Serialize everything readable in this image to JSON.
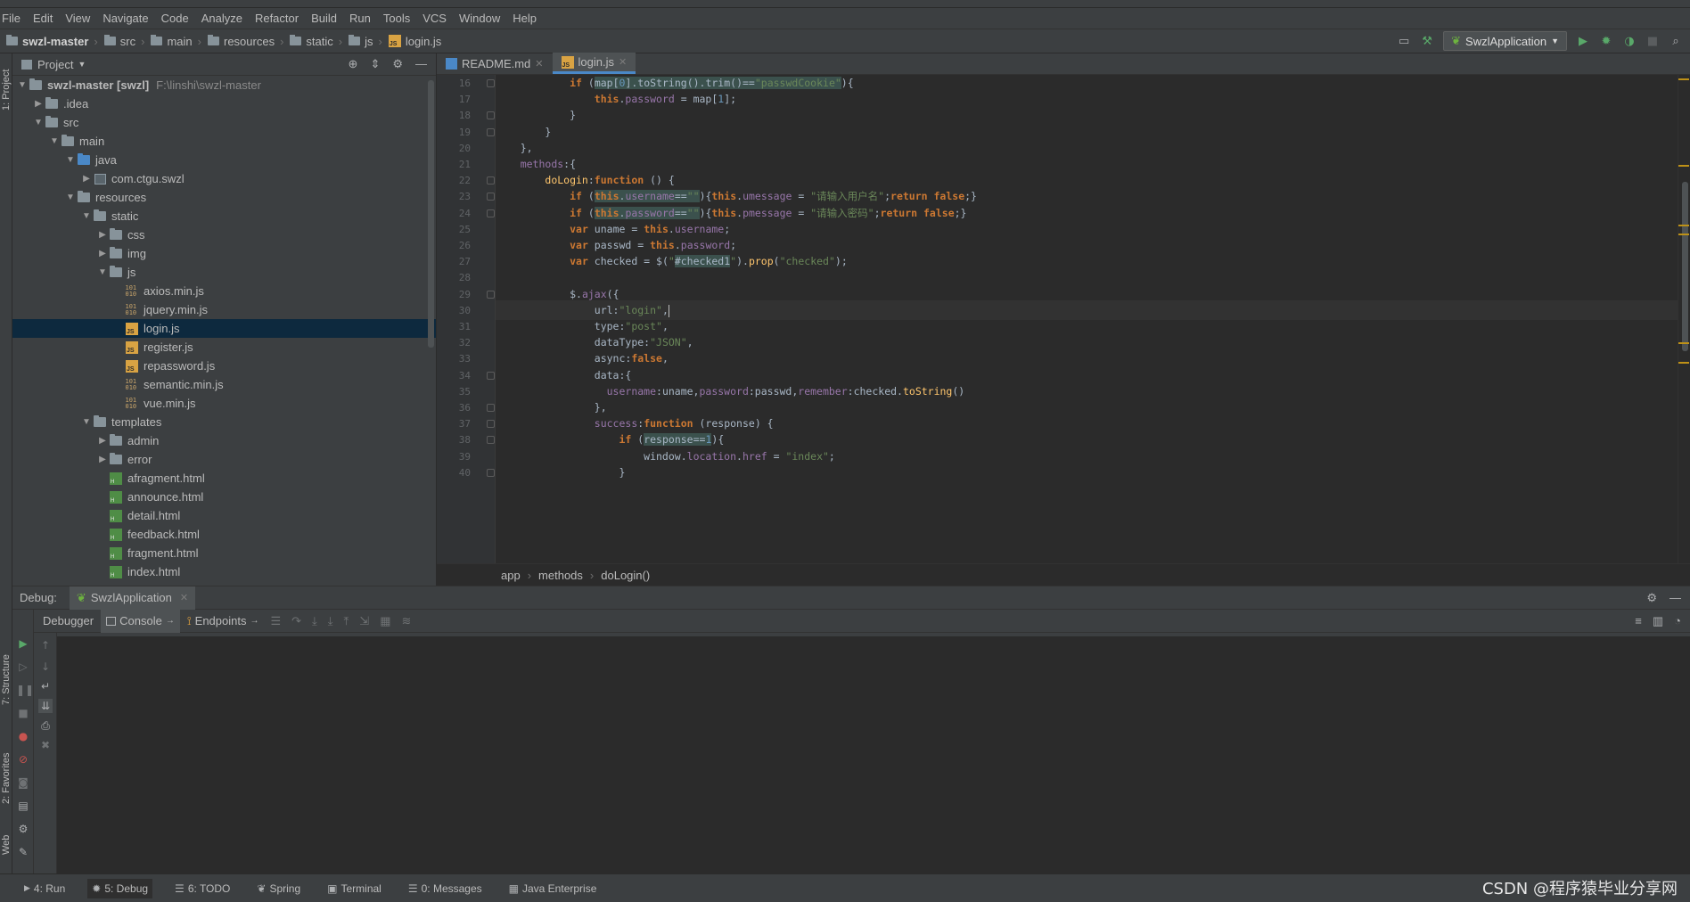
{
  "menu": [
    "File",
    "Edit",
    "View",
    "Navigate",
    "Code",
    "Analyze",
    "Refactor",
    "Build",
    "Run",
    "Tools",
    "VCS",
    "Window",
    "Help"
  ],
  "breadcrumbs": [
    "swzl-master",
    "src",
    "main",
    "resources",
    "static",
    "js",
    "login.js"
  ],
  "run_config": "SwzlApplication",
  "project": {
    "title": "Project",
    "tree": [
      {
        "label": "swzl-master [swzl]",
        "extra": "F:\\linshi\\swzl-master",
        "depth": 0,
        "type": "folder",
        "open": true,
        "bold": true
      },
      {
        "label": ".idea",
        "depth": 1,
        "type": "folder",
        "open": false
      },
      {
        "label": "src",
        "depth": 1,
        "type": "folder",
        "open": true
      },
      {
        "label": "main",
        "depth": 2,
        "type": "folder",
        "open": true
      },
      {
        "label": "java",
        "depth": 3,
        "type": "folder-blue",
        "open": true
      },
      {
        "label": "com.ctgu.swzl",
        "depth": 4,
        "type": "package",
        "open": false
      },
      {
        "label": "resources",
        "depth": 3,
        "type": "folder",
        "open": true
      },
      {
        "label": "static",
        "depth": 4,
        "type": "folder",
        "open": true
      },
      {
        "label": "css",
        "depth": 5,
        "type": "folder",
        "open": false
      },
      {
        "label": "img",
        "depth": 5,
        "type": "folder",
        "open": false
      },
      {
        "label": "js",
        "depth": 5,
        "type": "folder",
        "open": true
      },
      {
        "label": "axios.min.js",
        "depth": 6,
        "type": "bin"
      },
      {
        "label": "jquery.min.js",
        "depth": 6,
        "type": "bin"
      },
      {
        "label": "login.js",
        "depth": 6,
        "type": "js",
        "selected": true
      },
      {
        "label": "register.js",
        "depth": 6,
        "type": "js"
      },
      {
        "label": "repassword.js",
        "depth": 6,
        "type": "js"
      },
      {
        "label": "semantic.min.js",
        "depth": 6,
        "type": "bin"
      },
      {
        "label": "vue.min.js",
        "depth": 6,
        "type": "bin"
      },
      {
        "label": "templates",
        "depth": 4,
        "type": "folder",
        "open": true
      },
      {
        "label": "admin",
        "depth": 5,
        "type": "folder",
        "open": false
      },
      {
        "label": "error",
        "depth": 5,
        "type": "folder",
        "open": false
      },
      {
        "label": "afragment.html",
        "depth": 5,
        "type": "html"
      },
      {
        "label": "announce.html",
        "depth": 5,
        "type": "html"
      },
      {
        "label": "detail.html",
        "depth": 5,
        "type": "html"
      },
      {
        "label": "feedback.html",
        "depth": 5,
        "type": "html"
      },
      {
        "label": "fragment.html",
        "depth": 5,
        "type": "html"
      },
      {
        "label": "index.html",
        "depth": 5,
        "type": "html"
      }
    ]
  },
  "editor": {
    "tabs": [
      {
        "label": "README.md",
        "active": false
      },
      {
        "label": "login.js",
        "active": true
      }
    ],
    "first_line": 16,
    "current_line": 30,
    "lines": [
      [
        {
          "t": "            "
        },
        {
          "t": "if",
          "c": "kw"
        },
        {
          "t": " ("
        },
        {
          "t": "map[",
          "c": "hl"
        },
        {
          "t": "0",
          "c": "nu hl"
        },
        {
          "t": "].toString().trim()==",
          "c": "hl"
        },
        {
          "t": "\"passwdCookie\"",
          "c": "st hl"
        },
        {
          "t": "){"
        }
      ],
      [
        {
          "t": "                "
        },
        {
          "t": "this",
          "c": "kw"
        },
        {
          "t": "."
        },
        {
          "t": "password",
          "c": "pr"
        },
        {
          "t": " = map["
        },
        {
          "t": "1",
          "c": "nu"
        },
        {
          "t": "];"
        }
      ],
      [
        {
          "t": "            }"
        }
      ],
      [
        {
          "t": "        }"
        }
      ],
      [
        {
          "t": "    },"
        }
      ],
      [
        {
          "t": "    "
        },
        {
          "t": "methods",
          "c": "pr"
        },
        {
          "t": ":{"
        }
      ],
      [
        {
          "t": "        "
        },
        {
          "t": "doLogin",
          "c": "fn"
        },
        {
          "t": ":"
        },
        {
          "t": "function",
          "c": "kw"
        },
        {
          "t": " () {"
        }
      ],
      [
        {
          "t": "            "
        },
        {
          "t": "if",
          "c": "kw"
        },
        {
          "t": " ("
        },
        {
          "t": "this",
          "c": "kw hl"
        },
        {
          "t": ".",
          "c": "hl"
        },
        {
          "t": "username",
          "c": "pr hl"
        },
        {
          "t": "==",
          "c": "hl"
        },
        {
          "t": "\"\"",
          "c": "st hl"
        },
        {
          "t": "){"
        },
        {
          "t": "this",
          "c": "kw"
        },
        {
          "t": "."
        },
        {
          "t": "umessage",
          "c": "pr"
        },
        {
          "t": " = "
        },
        {
          "t": "\"请输入用户名\"",
          "c": "st"
        },
        {
          "t": ";"
        },
        {
          "t": "return false",
          "c": "kw"
        },
        {
          "t": ";}"
        }
      ],
      [
        {
          "t": "            "
        },
        {
          "t": "if",
          "c": "kw"
        },
        {
          "t": " ("
        },
        {
          "t": "this",
          "c": "kw hl"
        },
        {
          "t": ".",
          "c": "hl"
        },
        {
          "t": "password",
          "c": "pr hl"
        },
        {
          "t": "==",
          "c": "hl"
        },
        {
          "t": "\"\"",
          "c": "st hl"
        },
        {
          "t": "){"
        },
        {
          "t": "this",
          "c": "kw"
        },
        {
          "t": "."
        },
        {
          "t": "pmessage",
          "c": "pr"
        },
        {
          "t": " = "
        },
        {
          "t": "\"请输入密码\"",
          "c": "st"
        },
        {
          "t": ";"
        },
        {
          "t": "return false",
          "c": "kw"
        },
        {
          "t": ";}"
        }
      ],
      [
        {
          "t": "            "
        },
        {
          "t": "var",
          "c": "kw"
        },
        {
          "t": " uname = "
        },
        {
          "t": "this",
          "c": "kw"
        },
        {
          "t": "."
        },
        {
          "t": "username",
          "c": "pr"
        },
        {
          "t": ";"
        }
      ],
      [
        {
          "t": "            "
        },
        {
          "t": "var",
          "c": "kw"
        },
        {
          "t": " passwd = "
        },
        {
          "t": "this",
          "c": "kw"
        },
        {
          "t": "."
        },
        {
          "t": "password",
          "c": "pr"
        },
        {
          "t": ";"
        }
      ],
      [
        {
          "t": "            "
        },
        {
          "t": "var",
          "c": "kw"
        },
        {
          "t": " checked = $("
        },
        {
          "t": "\"",
          "c": "st"
        },
        {
          "t": "#checked1",
          "c": "hl"
        },
        {
          "t": "\"",
          "c": "st"
        },
        {
          "t": ")."
        },
        {
          "t": "prop",
          "c": "fn"
        },
        {
          "t": "("
        },
        {
          "t": "\"checked\"",
          "c": "st"
        },
        {
          "t": ");"
        }
      ],
      [
        {
          "t": ""
        }
      ],
      [
        {
          "t": "            $."
        },
        {
          "t": "ajax",
          "c": "pr"
        },
        {
          "t": "({"
        }
      ],
      [
        {
          "t": "                url:"
        },
        {
          "t": "\"login\"",
          "c": "st"
        },
        {
          "t": ","
        }
      ],
      [
        {
          "t": "                type:"
        },
        {
          "t": "\"post\"",
          "c": "st"
        },
        {
          "t": ","
        }
      ],
      [
        {
          "t": "                dataType:"
        },
        {
          "t": "\"JSON\"",
          "c": "st"
        },
        {
          "t": ","
        }
      ],
      [
        {
          "t": "                async:"
        },
        {
          "t": "false",
          "c": "kw"
        },
        {
          "t": ","
        }
      ],
      [
        {
          "t": "                data:{"
        }
      ],
      [
        {
          "t": "                  "
        },
        {
          "t": "username",
          "c": "pr"
        },
        {
          "t": ":uname,"
        },
        {
          "t": "password",
          "c": "pr"
        },
        {
          "t": ":passwd,"
        },
        {
          "t": "remember",
          "c": "pr"
        },
        {
          "t": ":checked."
        },
        {
          "t": "toString",
          "c": "fn"
        },
        {
          "t": "()"
        }
      ],
      [
        {
          "t": "                },"
        }
      ],
      [
        {
          "t": "                "
        },
        {
          "t": "success",
          "c": "pr"
        },
        {
          "t": ":"
        },
        {
          "t": "function",
          "c": "kw"
        },
        {
          "t": " (response) {"
        }
      ],
      [
        {
          "t": "                    "
        },
        {
          "t": "if",
          "c": "kw"
        },
        {
          "t": " ("
        },
        {
          "t": "response==",
          "c": "hl"
        },
        {
          "t": "1",
          "c": "nu hl"
        },
        {
          "t": "){"
        }
      ],
      [
        {
          "t": "                        window."
        },
        {
          "t": "location",
          "c": "pr"
        },
        {
          "t": "."
        },
        {
          "t": "href",
          "c": "pr"
        },
        {
          "t": " = "
        },
        {
          "t": "\"index\"",
          "c": "st"
        },
        {
          "t": ";"
        }
      ],
      [
        {
          "t": "                    }"
        }
      ]
    ],
    "code_breadcrumbs": [
      "app",
      "methods",
      "doLogin()"
    ]
  },
  "debug": {
    "title": "Debug:",
    "session": "SwzlApplication",
    "tabs": [
      "Debugger",
      "Console",
      "Endpoints"
    ]
  },
  "left_strip": [
    "1: Project",
    "7: Structure",
    "2: Favorites",
    "Web"
  ],
  "bottom": [
    {
      "label": "4: Run"
    },
    {
      "label": "5: Debug",
      "active": true
    },
    {
      "label": "6: TODO"
    },
    {
      "label": "Spring"
    },
    {
      "label": "Terminal"
    },
    {
      "label": "0: Messages"
    },
    {
      "label": "Java Enterprise"
    }
  ],
  "watermark": "CSDN @程序猿毕业分享网"
}
